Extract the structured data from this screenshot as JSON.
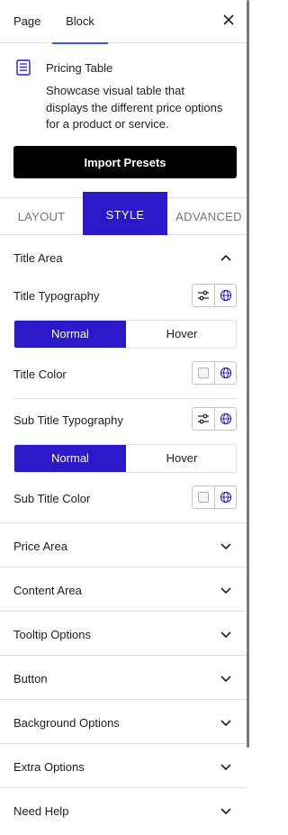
{
  "header": {
    "tabs": [
      "Page",
      "Block"
    ],
    "active_tab": "Block",
    "close_icon": "close-icon"
  },
  "block": {
    "icon": "table-icon",
    "title": "Pricing Table",
    "description": "Showcase visual table that displays the different price options for a product or service.",
    "import_label": "Import Presets"
  },
  "style_tabs": {
    "items": [
      "LAYOUT",
      "STYLE",
      "ADVANCED"
    ],
    "active": "STYLE"
  },
  "title_area": {
    "heading": "Title Area",
    "title_typography": "Title Typography",
    "title_state": {
      "normal": "Normal",
      "hover": "Hover",
      "active": "Normal"
    },
    "title_color": "Title Color",
    "sub_title_typography": "Sub Title Typography",
    "sub_title_state": {
      "normal": "Normal",
      "hover": "Hover",
      "active": "Normal"
    },
    "sub_title_color": "Sub Title Color"
  },
  "sections": [
    "Price Area",
    "Content Area",
    "Tooltip Options",
    "Button",
    "Background Options",
    "Extra Options",
    "Need Help"
  ],
  "colors": {
    "accent": "#2b19c9",
    "tab_underline": "#3858e9",
    "import_button": "#000000"
  }
}
